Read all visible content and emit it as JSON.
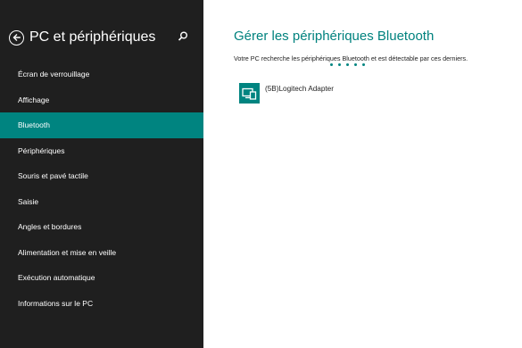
{
  "sidebar": {
    "title": "PC et périphériques",
    "items": [
      {
        "label": "Écran de verrouillage"
      },
      {
        "label": "Affichage"
      },
      {
        "label": "Bluetooth"
      },
      {
        "label": "Périphériques"
      },
      {
        "label": "Souris et pavé tactile"
      },
      {
        "label": "Saisie"
      },
      {
        "label": "Angles et bordures"
      },
      {
        "label": "Alimentation et mise en veille"
      },
      {
        "label": "Exécution automatique"
      },
      {
        "label": "Informations sur le PC"
      }
    ],
    "active_item": "Bluetooth"
  },
  "main": {
    "title": "Gérer les périphériques Bluetooth",
    "description": "Votre PC recherche les périphériques Bluetooth et est détectable par ces derniers.",
    "devices": [
      {
        "name": "(5B)Logitech Adapter",
        "icon": "bluetooth-device-icon"
      }
    ]
  },
  "colors": {
    "sidebar_bg": "#1f1f1f",
    "accent": "#008480",
    "title_text": "#00827e"
  },
  "icons": {
    "back": "back-arrow-icon",
    "search": "search-icon"
  }
}
